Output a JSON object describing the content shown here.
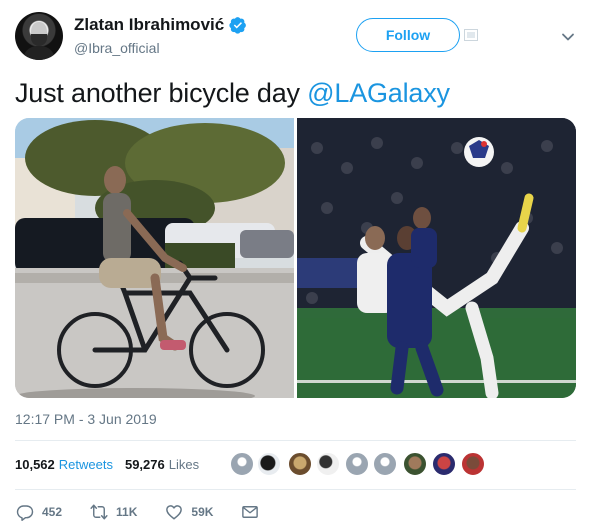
{
  "author": {
    "display_name": "Zlatan Ibrahimović",
    "handle": "@Ibra_official",
    "verified": true
  },
  "header": {
    "follow_label": "Follow"
  },
  "tweet": {
    "text": "Just another bicycle day ",
    "mention": "@LAGalaxy"
  },
  "media": {
    "photo_count": 2
  },
  "meta": {
    "timestamp": "12:17 PM - 3 Jun 2019"
  },
  "stats": {
    "retweets_count": "10,562",
    "retweets_label": "Retweets",
    "likes_count": "59,276",
    "likes_label": "Likes"
  },
  "actions": {
    "replies": "452",
    "retweets": "11K",
    "likes": "59K"
  },
  "colors": {
    "accent": "#1da1f2",
    "link": "#1b95e0",
    "secondary_text": "#657786"
  }
}
